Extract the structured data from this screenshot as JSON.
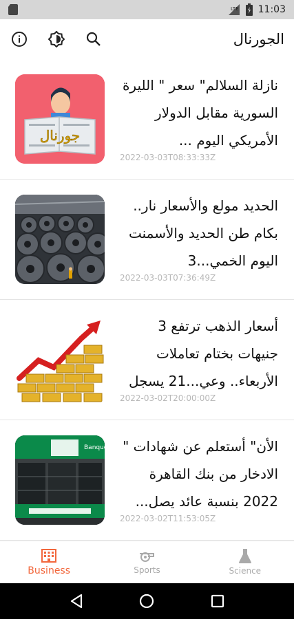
{
  "status_bar": {
    "time": "11:03"
  },
  "app_bar": {
    "title": "الجورنال",
    "actions": [
      {
        "name": "search-icon"
      },
      {
        "name": "theme-toggle-icon"
      },
      {
        "name": "info-icon"
      }
    ]
  },
  "articles": [
    {
      "headline": "نازلة السلالم\" سعر \" الليرة السورية مقابل الدولار الأمريكي اليوم ...",
      "date": "2022-03-03T08:33:33Z",
      "thumb_icon": "newspaper-reader-image",
      "thumb_text": "جورنال"
    },
    {
      "headline": "الحديد مولع والأسعار نار.. بكام طن الحديد والأسمنت اليوم الخمي...3",
      "date": "2022-03-03T07:36:49Z",
      "thumb_icon": "steel-coils-image"
    },
    {
      "headline": "أسعار الذهب ترتفع 3 جنيهات بختام تعاملات الأربعاء.. وعي...21 يسجل",
      "date": "2022-03-02T20:00:00Z",
      "thumb_icon": "gold-bars-chart-image"
    },
    {
      "headline": "الأن\" أستعلم عن شهادات \" الادخار من بنك القاهرة 2022 بنسبة عائد يصل...",
      "date": "2022-03-02T11:53:05Z",
      "thumb_icon": "banque-du-caire-image",
      "thumb_text": "Banque du Caire"
    }
  ],
  "bottom_nav": [
    {
      "label": "Business",
      "icon": "business-icon",
      "active": true
    },
    {
      "label": "Sports",
      "icon": "sports-icon",
      "active": false
    },
    {
      "label": "Science",
      "icon": "science-icon",
      "active": false
    }
  ],
  "colors": {
    "accent": "#f2673c",
    "inactive": "#a9a9a9",
    "date": "#b8b8b8"
  }
}
